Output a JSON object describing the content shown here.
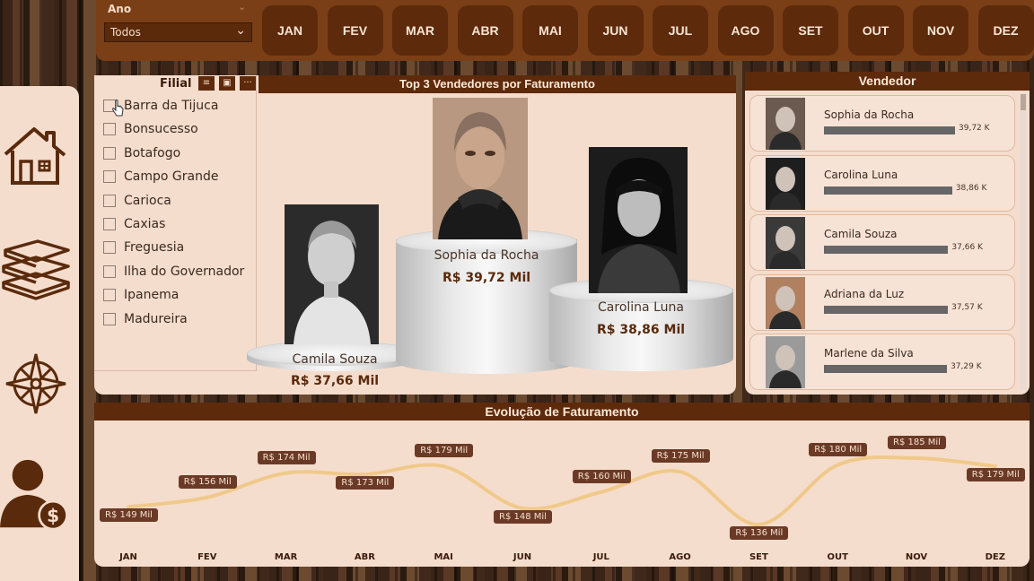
{
  "filters": {
    "ano_label": "Ano",
    "ano_selected": "Todos",
    "months": [
      "JAN",
      "FEV",
      "MAR",
      "ABR",
      "MAI",
      "JUN",
      "JUL",
      "AGO",
      "SET",
      "OUT",
      "NOV",
      "DEZ"
    ]
  },
  "sidebar": {
    "icons": [
      "home-icon",
      "books-icon",
      "compass-icon",
      "user-money-icon"
    ]
  },
  "filial": {
    "title": "Filial",
    "items": [
      "Barra da Tijuca",
      "Bonsucesso",
      "Botafogo",
      "Campo Grande",
      "Carioca",
      "Caxias",
      "Freguesia",
      "Ilha do Governador",
      "Ipanema",
      "Madureira"
    ]
  },
  "top3": {
    "title": "Top 3 Vendedores por Faturamento",
    "first": {
      "name": "Sophia da Rocha",
      "value": "R$ 39,72 Mil"
    },
    "second": {
      "name": "Carolina Luna",
      "value": "R$ 38,86 Mil"
    },
    "third": {
      "name": "Camila Souza",
      "value": "R$ 37,66 Mil"
    }
  },
  "vendedor": {
    "title": "Vendedor",
    "items": [
      {
        "name": "Sophia da Rocha",
        "label": "39,72 K",
        "value": 39.72
      },
      {
        "name": "Carolina Luna",
        "label": "38,86 K",
        "value": 38.86
      },
      {
        "name": "Camila Souza",
        "label": "37,66 K",
        "value": 37.66
      },
      {
        "name": "Adriana da Luz",
        "label": "37,57 K",
        "value": 37.57
      },
      {
        "name": "Marlene da Silva",
        "label": "37,29 K",
        "value": 37.29
      }
    ]
  },
  "chart_data": {
    "type": "line",
    "title": "Evolução de Faturamento",
    "categories": [
      "JAN",
      "FEV",
      "MAR",
      "ABR",
      "MAI",
      "JUN",
      "JUL",
      "AGO",
      "SET",
      "OUT",
      "NOV",
      "DEZ"
    ],
    "values": [
      149,
      156,
      174,
      173,
      179,
      148,
      160,
      175,
      136,
      180,
      185,
      179
    ],
    "labels": [
      "R$ 149 Mil",
      "R$ 156 Mil",
      "R$ 174 Mil",
      "R$ 173 Mil",
      "R$ 179 Mil",
      "R$ 148 Mil",
      "R$ 160 Mil",
      "R$ 175 Mil",
      "R$ 136 Mil",
      "R$ 180 Mil",
      "R$ 185 Mil",
      "R$ 179 Mil"
    ],
    "line_color": "#f0c98a",
    "label_bg": "#6b3a26"
  }
}
